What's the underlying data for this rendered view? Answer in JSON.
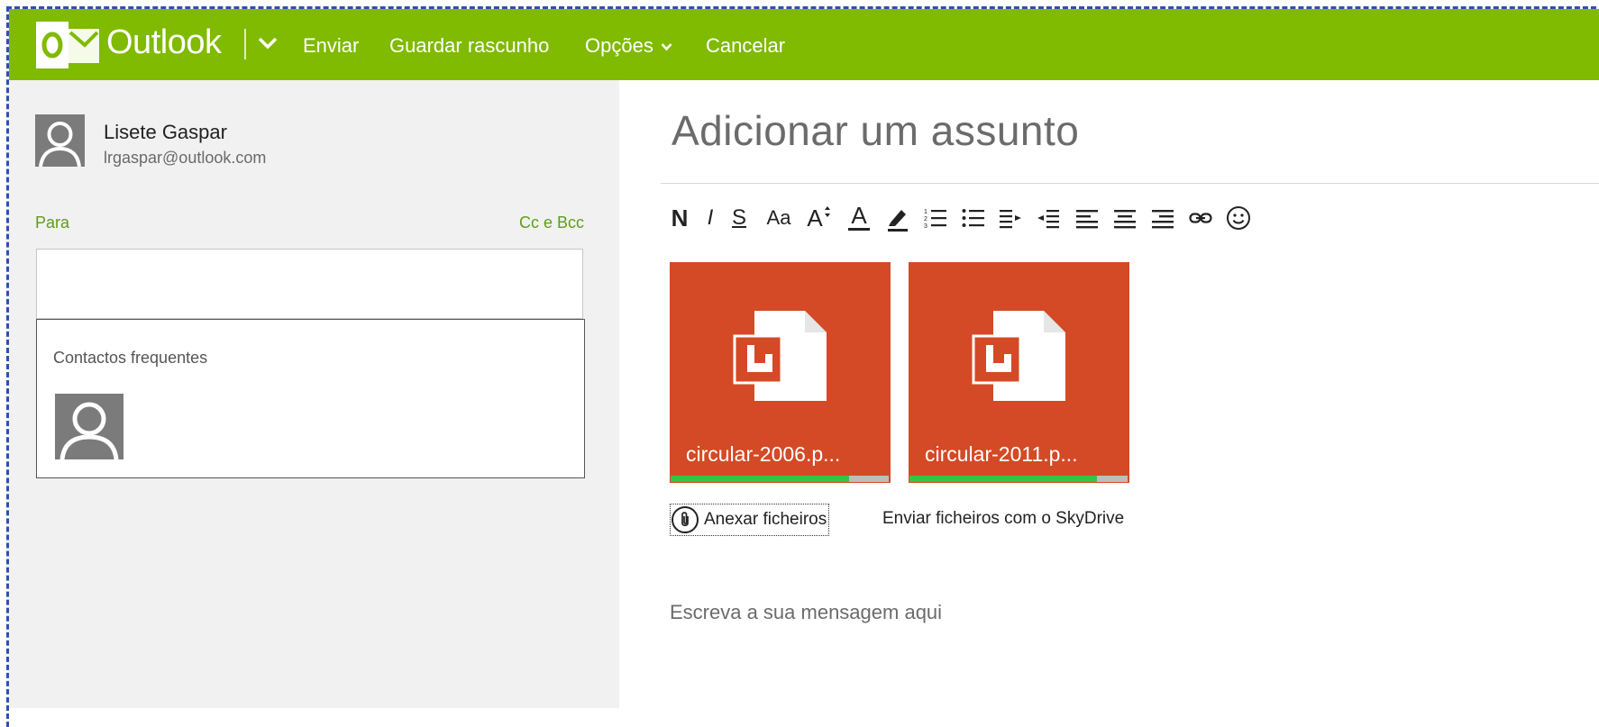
{
  "colors": {
    "brand_green": "#80ba01",
    "link_green": "#5d9e1a",
    "tile_orange": "#d44a26",
    "progress_green": "#35c446"
  },
  "header": {
    "app_name": "Outlook",
    "logo_icon": "outlook-logo-icon",
    "app_menu_icon": "chevron-down-icon",
    "actions": [
      {
        "label": "Enviar"
      },
      {
        "label": "Guardar rascunho"
      },
      {
        "label": "Opções",
        "icon": "chevron-down-icon"
      },
      {
        "label": "Cancelar"
      }
    ]
  },
  "sender": {
    "name": "Lisete Gaspar",
    "email": "lrgaspar@outlook.com",
    "avatar_icon": "person-silhouette-icon"
  },
  "recipients": {
    "to_label": "Para",
    "cc_bcc_label": "Cc e Bcc",
    "to_value": "",
    "frequent_contacts_title": "Contactos frequentes",
    "frequent_contacts": [
      {
        "avatar_icon": "person-silhouette-icon"
      }
    ]
  },
  "compose": {
    "subject_placeholder": "Adicionar um assunto",
    "body_placeholder": "Escreva a sua mensagem aqui",
    "toolbar": [
      {
        "name": "bold",
        "glyph": "N",
        "icon": "bold-icon"
      },
      {
        "name": "italic",
        "glyph": "I",
        "icon": "italic-icon"
      },
      {
        "name": "underline",
        "glyph": "S",
        "icon": "underline-icon"
      },
      {
        "name": "font",
        "glyph": "Aa",
        "icon": "font-icon"
      },
      {
        "name": "font-size",
        "glyph": "A",
        "icon": "font-size-icon"
      },
      {
        "name": "font-color",
        "glyph": "A",
        "icon": "font-color-icon"
      },
      {
        "name": "highlight",
        "icon": "highlight-icon"
      },
      {
        "name": "numbered-list",
        "icon": "numbered-list-icon"
      },
      {
        "name": "bulleted-list",
        "icon": "bulleted-list-icon"
      },
      {
        "name": "decrease-indent",
        "icon": "decrease-indent-icon"
      },
      {
        "name": "increase-indent",
        "icon": "increase-indent-icon"
      },
      {
        "name": "align-left",
        "icon": "align-left-icon"
      },
      {
        "name": "align-center",
        "icon": "align-center-icon"
      },
      {
        "name": "align-right",
        "icon": "align-right-icon"
      },
      {
        "name": "link",
        "icon": "link-icon"
      },
      {
        "name": "emoticon",
        "icon": "smiley-icon"
      }
    ],
    "attachments": [
      {
        "name": "circular-2006.p...",
        "icon": "pdf-file-icon",
        "progress": 0.82
      },
      {
        "name": "circular-2011.p...",
        "icon": "pdf-file-icon",
        "progress": 0.86
      }
    ],
    "attach_files_label": "Anexar ficheiros",
    "attach_icon": "paperclip-icon",
    "skydrive_label": "Enviar ficheiros com o SkyDrive"
  }
}
